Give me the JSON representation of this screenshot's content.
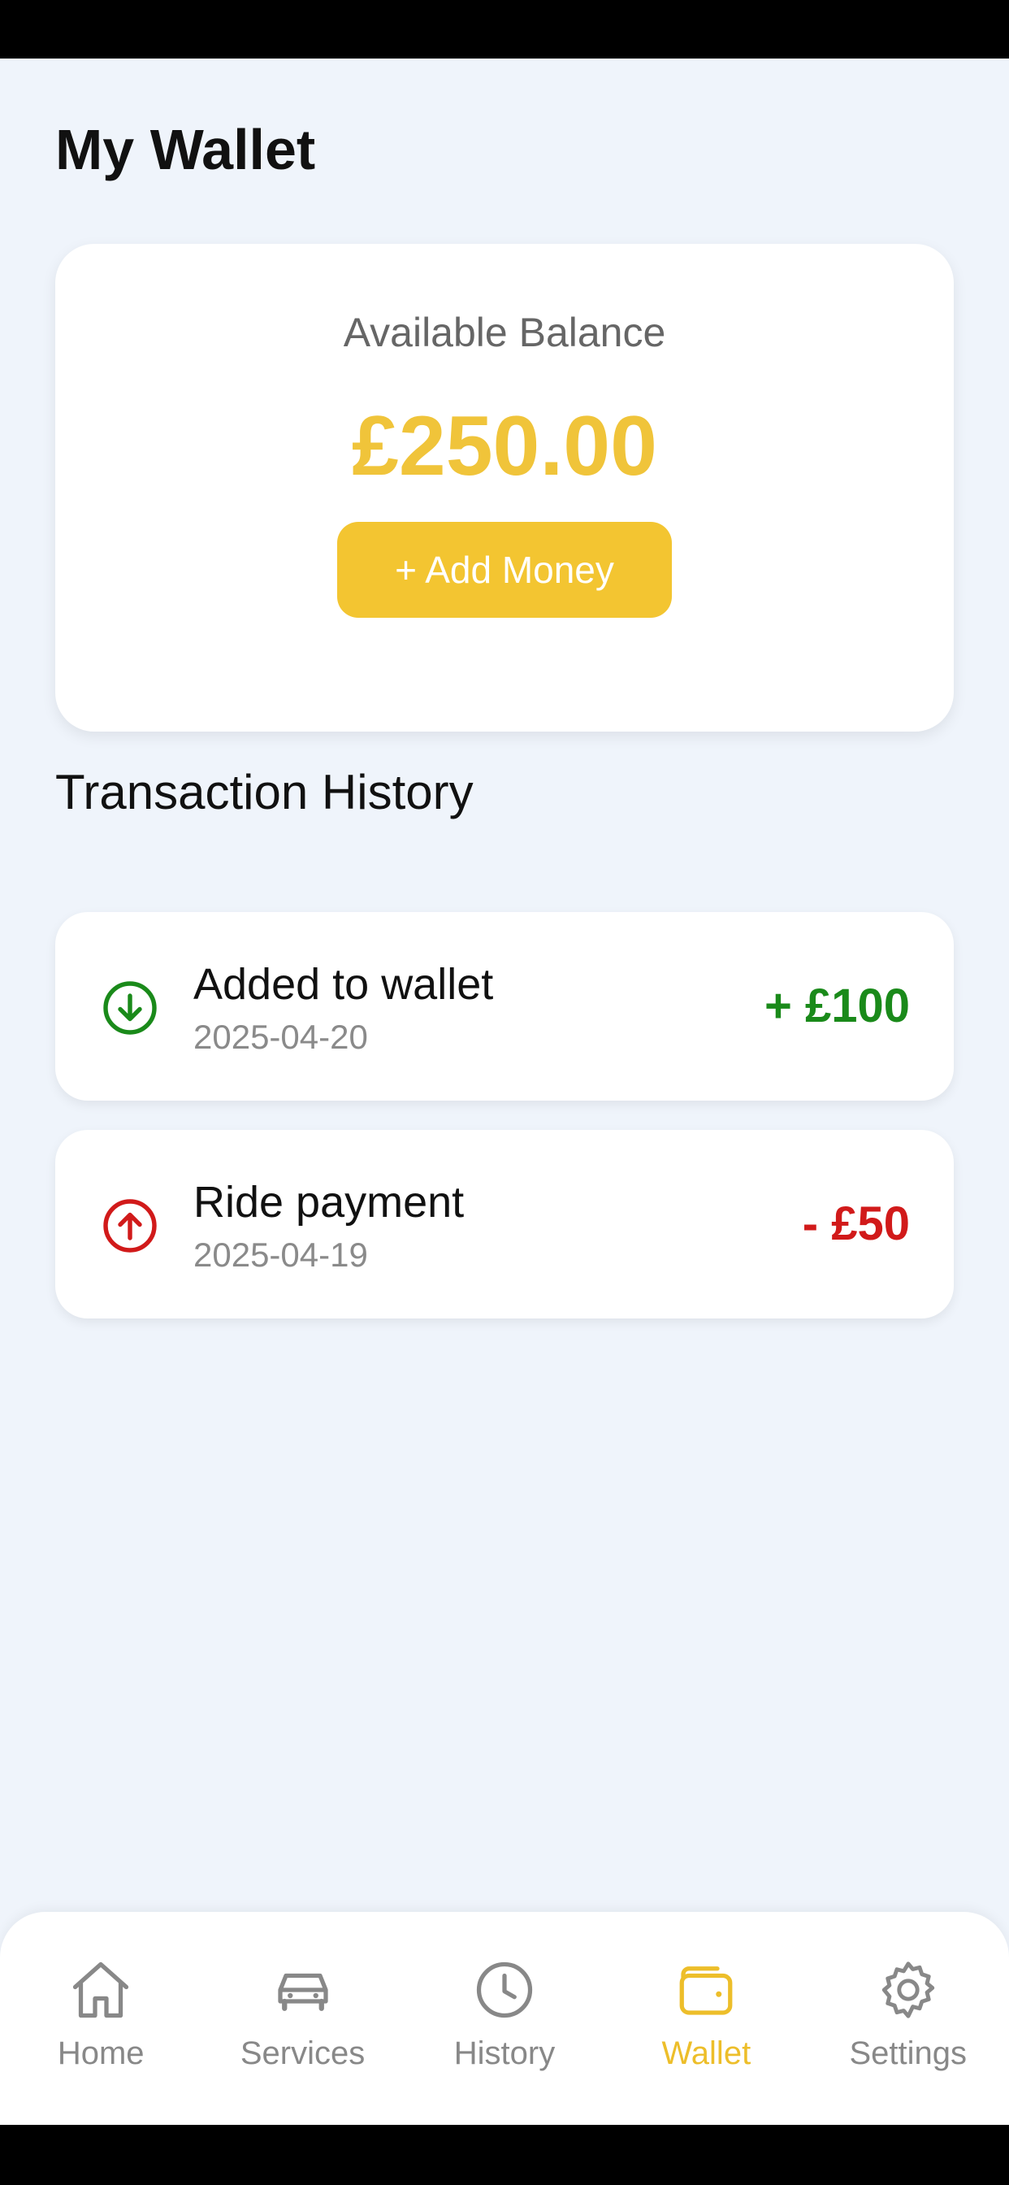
{
  "page": {
    "title": "My Wallet"
  },
  "balance": {
    "label": "Available Balance",
    "amount": "£250.00",
    "add_money_label": "+ Add Money"
  },
  "transactions": {
    "title": "Transaction History",
    "items": [
      {
        "title": "Added to wallet",
        "date": "2025-04-20",
        "amount": "+ £100",
        "type": "credit",
        "icon": "arrow-down-circle-icon"
      },
      {
        "title": "Ride payment",
        "date": "2025-04-19",
        "amount": "- £50",
        "type": "debit",
        "icon": "arrow-up-circle-icon"
      }
    ]
  },
  "nav": {
    "items": [
      {
        "label": "Home",
        "icon": "home-icon"
      },
      {
        "label": "Services",
        "icon": "car-icon"
      },
      {
        "label": "History",
        "icon": "clock-icon"
      },
      {
        "label": "Wallet",
        "icon": "wallet-icon",
        "active": true
      },
      {
        "label": "Settings",
        "icon": "gear-icon"
      }
    ]
  },
  "colors": {
    "accent": "#F3C531",
    "credit": "#1A8A1A",
    "debit": "#D11A1A",
    "background": "#EFF4FB"
  }
}
